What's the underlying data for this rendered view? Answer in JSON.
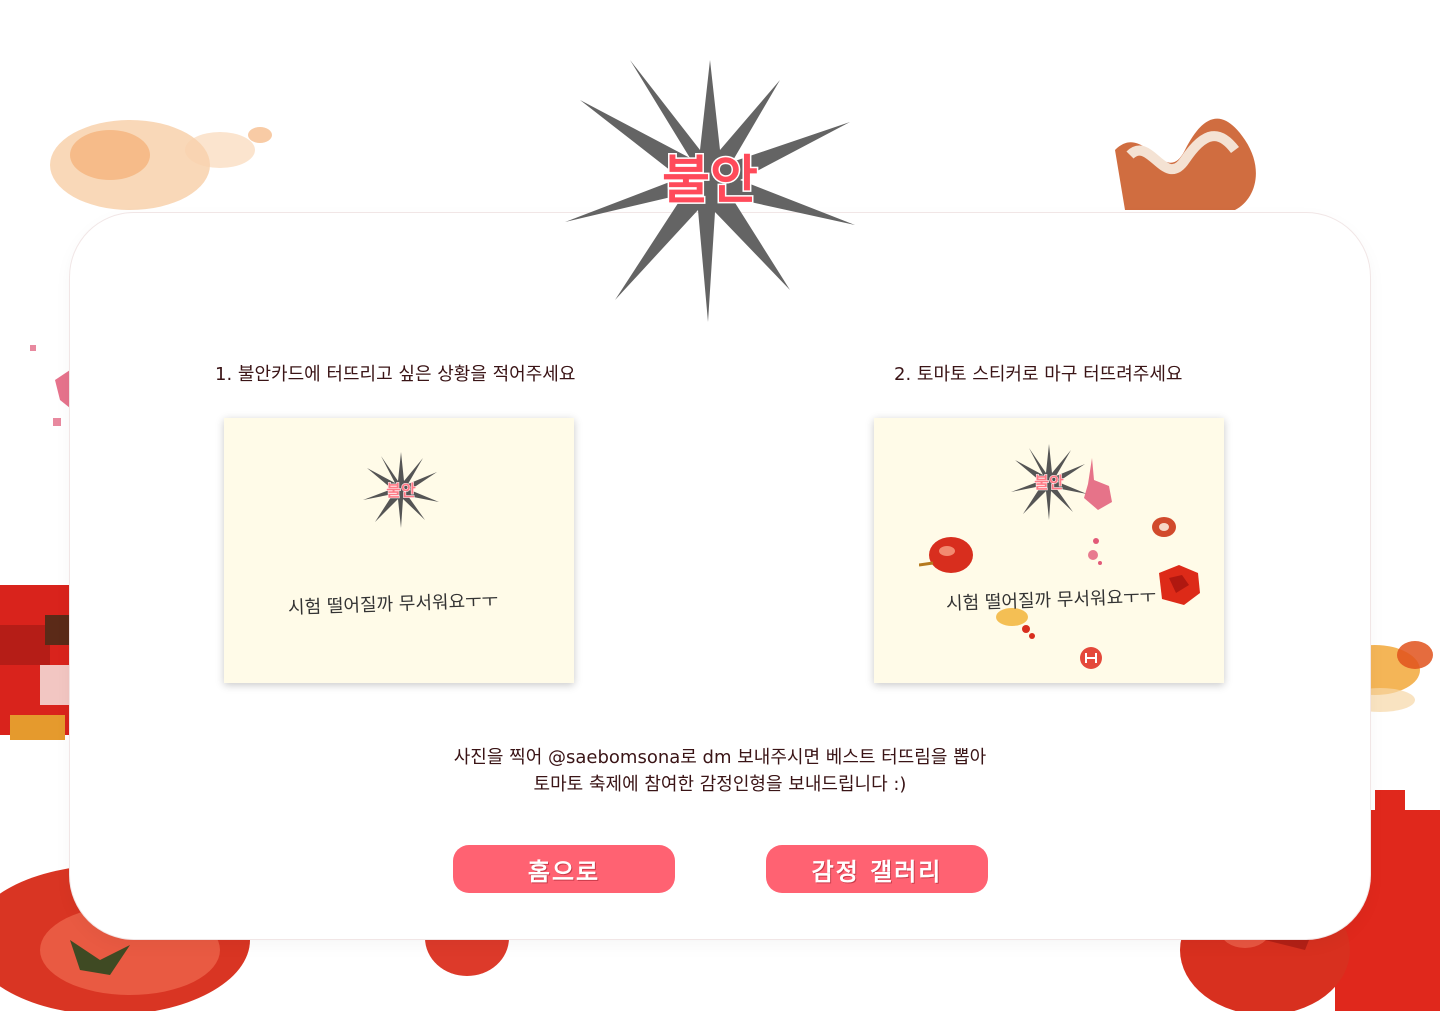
{
  "header": {
    "title": "불안"
  },
  "steps": {
    "step1": "1. 불안카드에 터뜨리고 싶은 상황을 적어주세요",
    "step2": "2. 토마토 스티커로 마구 터뜨려주세요"
  },
  "cards": {
    "left": {
      "badge": "불안",
      "text": "시험 떨어질까 무서워요ㅜㅜ"
    },
    "right": {
      "badge": "불안",
      "text": "시험 떨어질까 무서워요ㅜㅜ"
    }
  },
  "notice": {
    "line1": "사진을 찍어 @saebomsona로 dm 보내주시면 베스트 터뜨림을 뽑아",
    "line2": "토마토 축제에 참여한 감정인형을 보내드립니다 :)"
  },
  "buttons": {
    "home": "홈으로",
    "gallery": "감정 갤러리"
  },
  "colors": {
    "accent": "#ff6272",
    "star": "#646464",
    "card_bg": "#fffbe8",
    "title_fill": "#ff4a5a",
    "tomato_red": "#e0281c"
  },
  "icons": [
    "star-burst-icon",
    "tomato-splat-icon"
  ]
}
